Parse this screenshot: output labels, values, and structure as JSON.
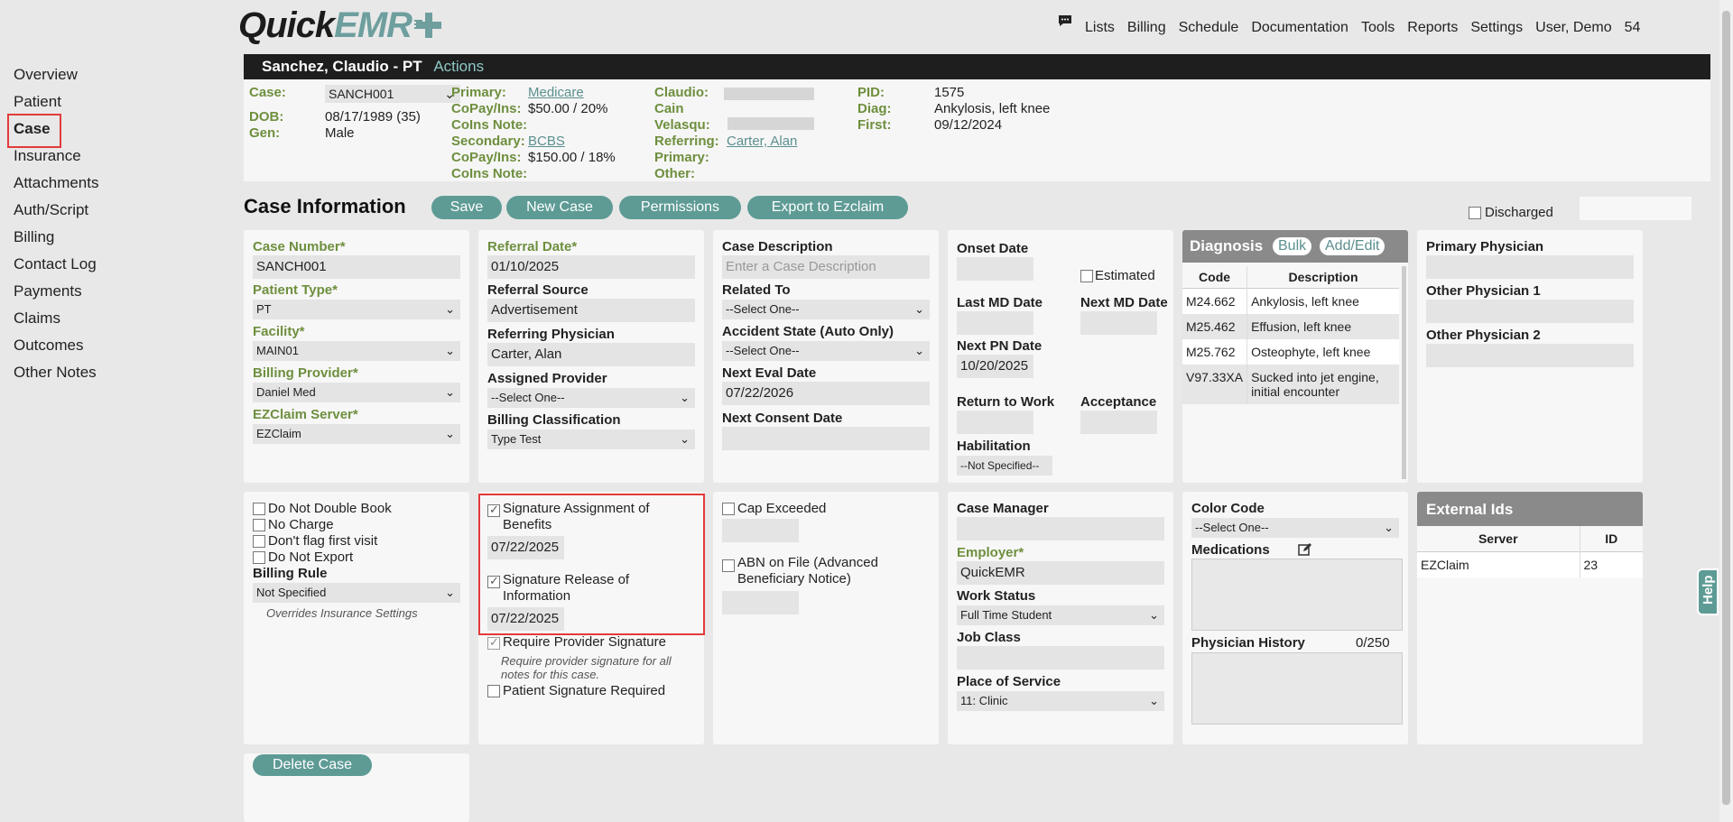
{
  "app": {
    "logo_a": "Quick",
    "logo_b": "EMR"
  },
  "topnav": [
    "Lists",
    "Billing",
    "Schedule",
    "Documentation",
    "Tools",
    "Reports",
    "Settings",
    "User, Demo",
    "54"
  ],
  "leftnav": [
    "Overview",
    "Patient",
    "Case",
    "Insurance",
    "Attachments",
    "Auth/Script",
    "Billing",
    "Contact Log",
    "Payments",
    "Claims",
    "Outcomes",
    "Other Notes"
  ],
  "patient": {
    "name": "Sanchez, Claudio - PT",
    "actions": "Actions",
    "case_label": "Case:",
    "case_value": "SANCH001",
    "dob_label": "DOB:",
    "dob_value": "08/17/1989 (35)",
    "gen_label": "Gen:",
    "gen_value": "Male",
    "primary_label": "Primary:",
    "primary_value": "Medicare",
    "copay_label": "CoPay/Ins:",
    "copay1": "$50.00 / 20%",
    "coins_label": "CoIns Note:",
    "secondary_label": "Secondary:",
    "secondary_value": "BCBS",
    "copay2": "$150.00 / 18%",
    "claudio": "Claudio:",
    "cain": "Cain",
    "velasqu": "Velasqu:",
    "referring_label": "Referring:",
    "referring_value": "Carter, Alan",
    "primary2": "Primary:",
    "other": "Other:",
    "pid_label": "PID:",
    "pid_value": "1575",
    "diag_label": "Diag:",
    "diag_value": "Ankylosis, left knee",
    "first_label": "First:",
    "first_value": "09/12/2024"
  },
  "case": {
    "title": "Case Information",
    "save": "Save",
    "new_case": "New Case",
    "permissions": "Permissions",
    "export": "Export to Ezclaim",
    "discharged": "Discharged"
  },
  "col1": {
    "case_number_label": "Case Number*",
    "case_number": "SANCH001",
    "patient_type_label": "Patient Type*",
    "patient_type": "PT",
    "facility_label": "Facility*",
    "facility": "MAIN01",
    "billing_provider_label": "Billing Provider*",
    "billing_provider": "Daniel Med",
    "ezclaim_label": "EZClaim Server*",
    "ezclaim": "EZClaim"
  },
  "col2": {
    "referral_date_label": "Referral Date*",
    "referral_date": "01/10/2025",
    "referral_source_label": "Referral Source",
    "referral_source": "Advertisement",
    "ref_phys_label": "Referring Physician",
    "ref_phys": "Carter, Alan",
    "assigned_label": "Assigned Provider",
    "assigned": "--Select One--",
    "billing_class_label": "Billing Classification",
    "billing_class": "Type Test"
  },
  "col3": {
    "case_desc_label": "Case Description",
    "case_desc_ph": "Enter a Case Description",
    "related_label": "Related To",
    "related": "--Select One--",
    "accident_label": "Accident State (Auto Only)",
    "accident": "--Select One--",
    "next_eval_label": "Next Eval Date",
    "next_eval": "07/22/2026",
    "next_consent_label": "Next Consent Date"
  },
  "col4": {
    "onset_label": "Onset Date",
    "estimated": "Estimated",
    "last_md_label": "Last MD Date",
    "next_md_label": "Next MD Date",
    "next_pn_label": "Next PN Date",
    "next_pn": "10/20/2025",
    "rtw_label": "Return to Work",
    "acceptance_label": "Acceptance",
    "habilitation_label": "Habilitation",
    "habilitation": "--Not Specified--"
  },
  "diagnosis": {
    "title": "Diagnosis",
    "bulk": "Bulk",
    "addedit": "Add/Edit",
    "col_code": "Code",
    "col_desc": "Description",
    "rows": [
      {
        "code": "M24.662",
        "desc": "Ankylosis, left knee"
      },
      {
        "code": "M25.462",
        "desc": "Effusion, left knee"
      },
      {
        "code": "M25.762",
        "desc": "Osteophyte, left knee"
      },
      {
        "code": "V97.33XA",
        "desc": "Sucked into jet engine, initial encounter"
      }
    ]
  },
  "col6": {
    "primary_phys": "Primary Physician",
    "other1": "Other Physician 1",
    "other2": "Other Physician 2"
  },
  "b1": {
    "no_double": "Do Not Double Book",
    "no_charge": "No Charge",
    "no_flag": "Don't flag first visit",
    "no_export": "Do Not Export",
    "billing_rule_label": "Billing Rule",
    "billing_rule": "Not Specified",
    "overrides": "Overrides Insurance Settings"
  },
  "b2": {
    "sig_assign": "Signature Assignment of Benefits",
    "sig_assign_date": "07/22/2025",
    "sig_release": "Signature Release of Information",
    "sig_release_date": "07/22/2025",
    "req_provider": "Require Provider Signature",
    "req_note": "Require provider signature for all notes for this case.",
    "patient_sig": "Patient Signature Required"
  },
  "b3": {
    "cap": "Cap Exceeded",
    "abn": "ABN on File (Advanced Beneficiary Notice)"
  },
  "b4": {
    "case_manager_label": "Case Manager",
    "employer_label": "Employer*",
    "employer": "QuickEMR",
    "work_status_label": "Work Status",
    "work_status": "Full Time Student",
    "job_class_label": "Job Class",
    "pos_label": "Place of Service",
    "pos": "11: Clinic"
  },
  "b5": {
    "color_code_label": "Color Code",
    "color_code": "--Select One--",
    "medications_label": "Medications",
    "phys_history_label": "Physician History",
    "phys_history_count": "0/250"
  },
  "external": {
    "title": "External Ids",
    "col_server": "Server",
    "col_id": "ID",
    "rows": [
      {
        "server": "EZClaim",
        "id": "23"
      }
    ]
  },
  "delete": "Delete Case",
  "help": "Help"
}
